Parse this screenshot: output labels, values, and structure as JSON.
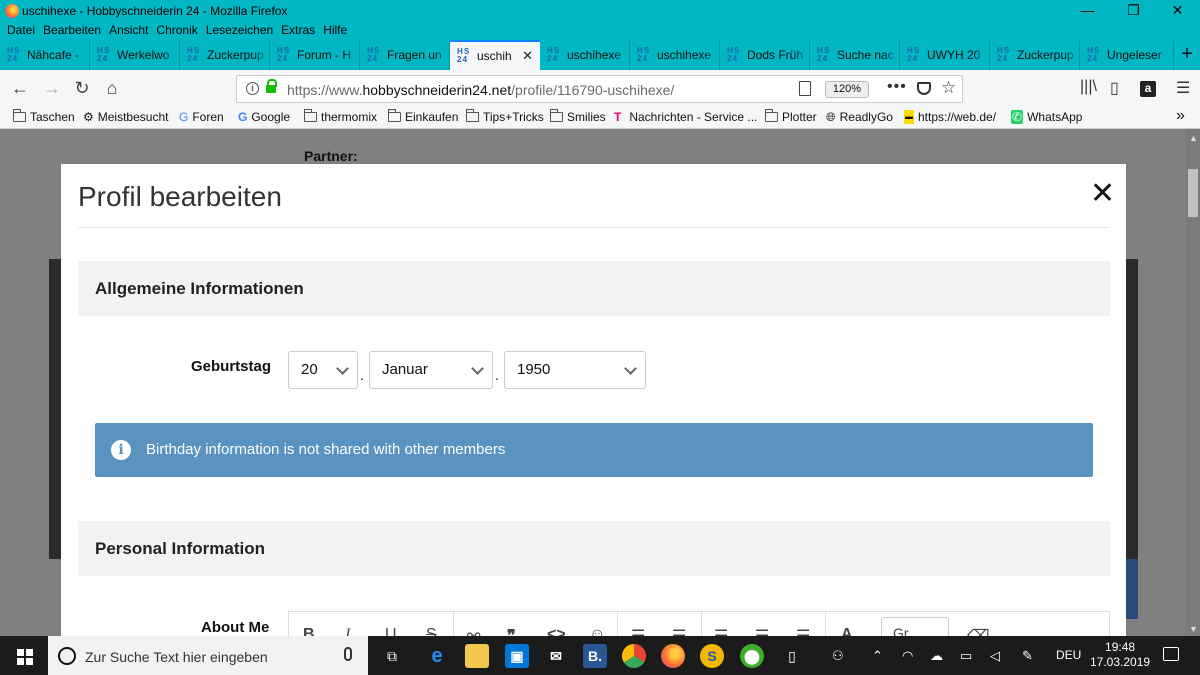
{
  "window": {
    "title": "uschihexe - Hobbyschneiderin 24 - Mozilla Firefox",
    "controls": [
      "—",
      "❐",
      "✕"
    ]
  },
  "menu": [
    "Datei",
    "Bearbeiten",
    "Ansicht",
    "Chronik",
    "Lesezeichen",
    "Extras",
    "Hilfe"
  ],
  "tabs": [
    {
      "icon": "HS 24",
      "label": "Nähcafe -"
    },
    {
      "icon": "HS 24",
      "label": "Werkelwo"
    },
    {
      "icon": "HS 24",
      "label": "Zuckerpup"
    },
    {
      "icon": "HS 24",
      "label": "Forum - H"
    },
    {
      "icon": "HS 24",
      "label": "Fragen un"
    },
    {
      "icon": "HS 24",
      "label": "uschih",
      "active": true
    },
    {
      "icon": "HS 24",
      "label": "uschihexe"
    },
    {
      "icon": "HS 24",
      "label": "uschihexe"
    },
    {
      "icon": "HS 24",
      "label": "Dods Früh"
    },
    {
      "icon": "HS 24",
      "label": "Suche nac"
    },
    {
      "icon": "HS 24",
      "label": "UWYH 20"
    },
    {
      "icon": "HS 24",
      "label": "Zuckerpup"
    },
    {
      "icon": "HS 24",
      "label": "Ungeleser"
    }
  ],
  "tab_close": "✕",
  "new_tab": "+",
  "nav": {
    "url_prefix": "https://www.",
    "url_domain": "hobbyschneiderin24.net",
    "url_path": "/profile/116790-uschihexe/",
    "zoom": "120%"
  },
  "bookmarks": [
    {
      "label": "Taschen",
      "icon": "folder"
    },
    {
      "label": "Meistbesucht",
      "icon": "gear"
    },
    {
      "label": "Foren",
      "icon": "G"
    },
    {
      "label": "Google",
      "icon": "G"
    },
    {
      "label": "thermomix",
      "icon": "folder"
    },
    {
      "label": "Einkaufen",
      "icon": "folder"
    },
    {
      "label": "Tips+Tricks",
      "icon": "folder"
    },
    {
      "label": "Smilies",
      "icon": "folder"
    },
    {
      "label": "Nachrichten - Service ...",
      "icon": "T"
    },
    {
      "label": "Plotter",
      "icon": "folder"
    },
    {
      "label": "ReadlyGo",
      "icon": "globe"
    },
    {
      "label": "https://web.de/",
      "icon": "web"
    },
    {
      "label": "WhatsApp",
      "icon": "whatsapp"
    }
  ],
  "bookmarks_overflow": "»",
  "background": {
    "partner_label": "Partner:"
  },
  "modal": {
    "title": "Profil bearbeiten",
    "close": "✕",
    "section1": "Allgemeine Informationen",
    "birthday_label": "Geburtstag",
    "day": "20",
    "month": "Januar",
    "year": "1950",
    "separator": ".",
    "notice": "Birthday information is not shared with other members",
    "section2": "Personal Information",
    "about_label": "About Me",
    "editor_font": "Gr"
  },
  "taskbar": {
    "search_placeholder": "Zur Suche Text hier eingeben",
    "lang": "DEU",
    "time": "19:48",
    "date": "17.03.2019"
  },
  "colors": {
    "titlebar": "#00b7c3",
    "notice": "#5a93bf",
    "accent": "#0a84ff"
  }
}
